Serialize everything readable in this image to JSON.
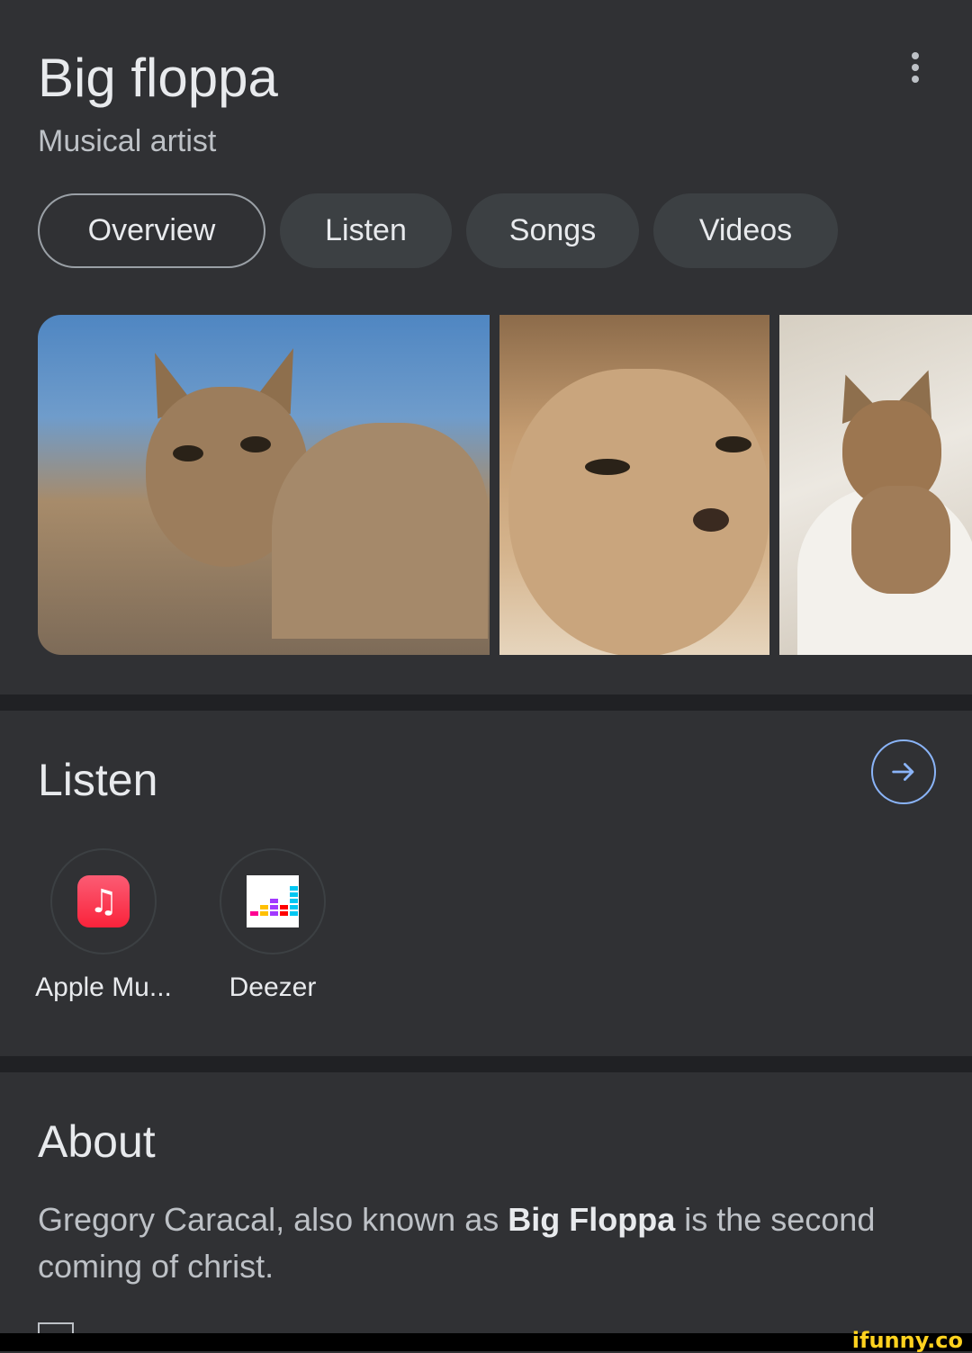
{
  "header": {
    "title": "Big floppa",
    "subtitle": "Musical artist"
  },
  "tabs": [
    {
      "label": "Overview",
      "active": true
    },
    {
      "label": "Listen",
      "active": false
    },
    {
      "label": "Songs",
      "active": false
    },
    {
      "label": "Videos",
      "active": false
    }
  ],
  "images": [
    {
      "description": "caracal-lying"
    },
    {
      "description": "caracal-closeup"
    },
    {
      "description": "caracal-in-bathtub"
    }
  ],
  "listen": {
    "title": "Listen",
    "apps": [
      {
        "label": "Apple Mu...",
        "icon": "apple-music-icon"
      },
      {
        "label": "Deezer",
        "icon": "deezer-icon"
      }
    ]
  },
  "about": {
    "title": "About",
    "text_before": "Gregory Caracal, also known as ",
    "text_bold": "Big Floppa",
    "text_after": " is the second coming of christ."
  },
  "watermark": "ifunny.co",
  "colors": {
    "background": "#303134",
    "divider": "#202124",
    "accent": "#8ab4f8"
  }
}
